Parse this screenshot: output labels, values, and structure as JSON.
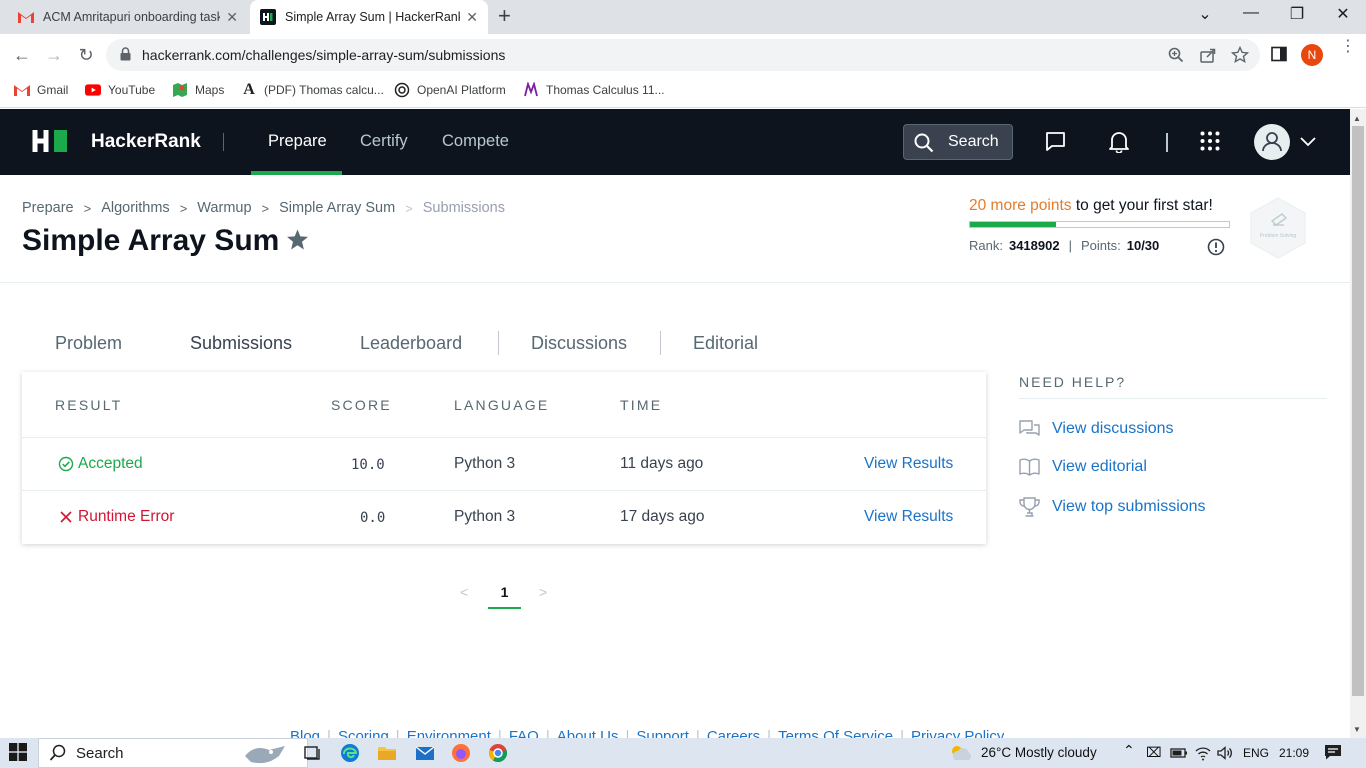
{
  "browser": {
    "tabs": [
      {
        "title": "ACM Amritapuri onboarding task",
        "favicon": "gmail-icon"
      },
      {
        "title": "Simple Array Sum | HackerRank",
        "favicon": "hackerrank-icon"
      }
    ],
    "url": "hackerrank.com/challenges/simple-array-sum/submissions",
    "profile_initial": "N",
    "bookmarks": [
      {
        "label": "Gmail",
        "icon": "gmail-icon"
      },
      {
        "label": "YouTube",
        "icon": "youtube-icon"
      },
      {
        "label": "Maps",
        "icon": "maps-icon"
      },
      {
        "label": "(PDF) Thomas calcu...",
        "icon": "academia-icon"
      },
      {
        "label": "OpenAI Platform",
        "icon": "openai-icon"
      },
      {
        "label": "Thomas Calculus 11...",
        "icon": "document-icon"
      }
    ]
  },
  "header": {
    "brand": "HackerRank",
    "nav": [
      "Prepare",
      "Certify",
      "Compete"
    ],
    "active_nav": "Prepare",
    "search_label": "Search"
  },
  "breadcrumb": [
    "Prepare",
    "Algorithms",
    "Warmup",
    "Simple Array Sum",
    "Submissions"
  ],
  "page_title": "Simple Array Sum",
  "progress": {
    "points_needed": "20 more points",
    "message_rest": " to get your first star!",
    "fraction": 0.333,
    "rank_label": "Rank:",
    "rank_value": "3418902",
    "points_label": "Points:",
    "points_value": "10/30",
    "badge_label": "Problem Solving"
  },
  "tabs": [
    "Problem",
    "Submissions",
    "Leaderboard",
    "Discussions",
    "Editorial"
  ],
  "active_tab": "Submissions",
  "table": {
    "headers": [
      "RESULT",
      "SCORE",
      "LANGUAGE",
      "TIME"
    ],
    "rows": [
      {
        "result": "Accepted",
        "status": "accepted",
        "score": "10.0",
        "language": "Python 3",
        "time": "11 days ago",
        "action": "View Results"
      },
      {
        "result": "Runtime Error",
        "status": "error",
        "score": "0.0",
        "language": "Python 3",
        "time": "17 days ago",
        "action": "View Results"
      }
    ]
  },
  "pagination": {
    "current": "1"
  },
  "help": {
    "title": "NEED HELP?",
    "items": [
      "View discussions",
      "View editorial",
      "View top submissions"
    ]
  },
  "footer": [
    "Blog",
    "Scoring",
    "Environment",
    "FAQ",
    "About Us",
    "Support",
    "Careers",
    "Terms Of Service",
    "Privacy Policy"
  ],
  "taskbar": {
    "search": "Search",
    "weather": "26°C  Mostly cloudy",
    "language": "ENG",
    "clock": "21:09"
  },
  "colors": {
    "brand_green": "#1ba94c",
    "header_bg": "#0e141e",
    "link_blue": "#1a73c8",
    "error_red": "#d11534",
    "points_orange": "#e47c2b"
  }
}
